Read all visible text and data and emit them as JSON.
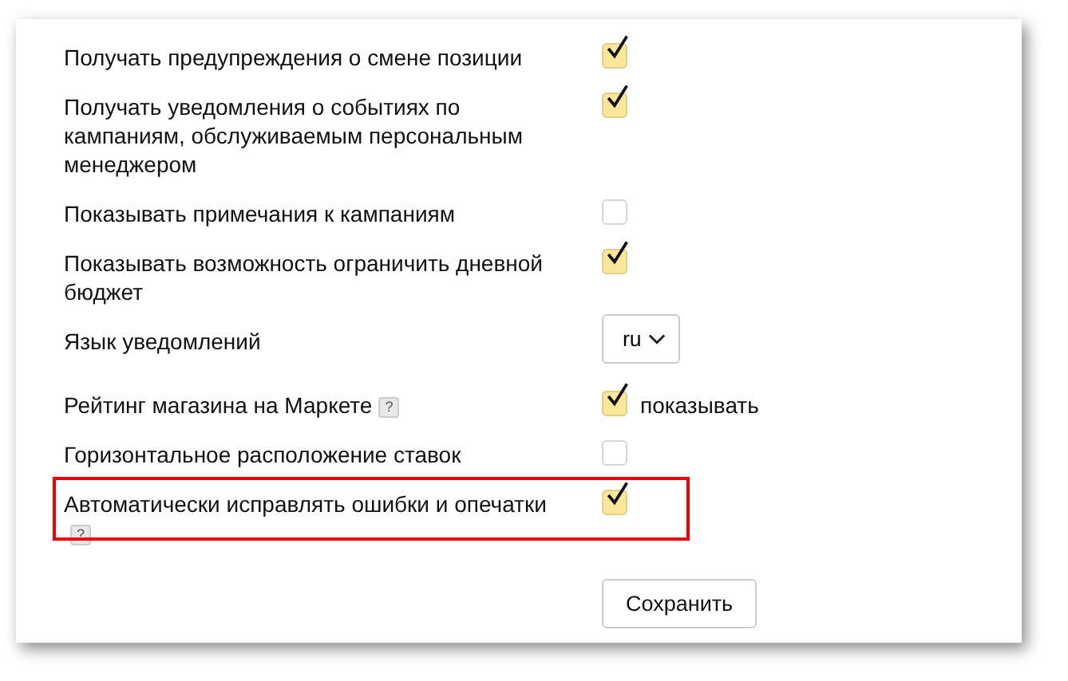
{
  "settings": [
    {
      "kind": "checkbox",
      "label": "Получать предупреждения о смене позиции",
      "checked": true
    },
    {
      "kind": "checkbox",
      "label": "Получать уведомления о событиях по кампаниям, обслуживаемым персональным менеджером",
      "checked": true
    },
    {
      "kind": "checkbox",
      "label": "Показывать примечания к кампаниям",
      "checked": false
    },
    {
      "kind": "checkbox",
      "label": "Показывать возможность ограничить дневной бюджет",
      "checked": true
    },
    {
      "kind": "select",
      "label": "Язык уведомлений",
      "value": "ru"
    },
    {
      "kind": "checkbox",
      "label": "Рейтинг магазина на Маркете",
      "help": "?",
      "checked": true,
      "option_label": "показывать"
    },
    {
      "kind": "checkbox",
      "label": "Горизонтальное расположение ставок",
      "checked": false
    },
    {
      "kind": "checkbox",
      "label": "Автоматически исправлять ошибки и опечатки",
      "help": "?",
      "checked": true,
      "highlighted": true
    }
  ],
  "save_button": "Сохранить"
}
